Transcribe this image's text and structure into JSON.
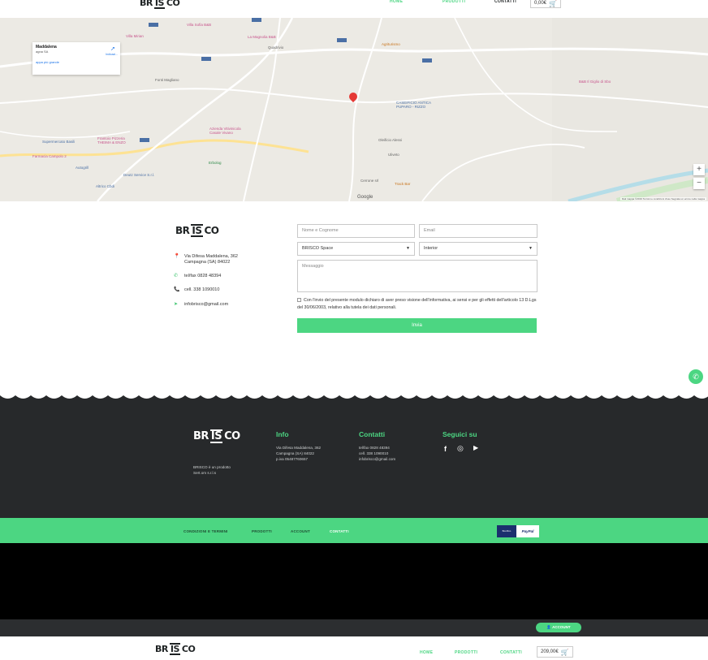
{
  "brand": {
    "left": "BR",
    "mid": "IS",
    "right": "CO"
  },
  "nav": {
    "home": "HOME",
    "products": "PRODOTTI",
    "contacts": "CONTATTI",
    "cart_total": "0,00€"
  },
  "map": {
    "card_title": "Maddalena",
    "card_subtitle": "agna SA",
    "card_link": "appa più grande",
    "directions_label": "Indicazi...",
    "zoom_in": "+",
    "zoom_out": "−",
    "google": "Google",
    "attribution": "Dati mappa ©2019   Termini e condizioni d'uso   Segnala un errore nella mappa",
    "labels": {
      "villa_sofia": "Villa Sofia B&B",
      "la_magnolia": "La Magnolia B&B",
      "quadrivio": "Quadrivio",
      "villa_mirian": "Villa Mirian",
      "agriturismo": "Agriturismo",
      "fonti_magliano": "Fonti Magliano",
      "caseificio": "CASEIFICIO ANTICA\nPUPARO - RIZZO",
      "azienda": "Azienda Vitivinicola\nCasale Vivano",
      "supermercato": "Supermercato Basili",
      "frantoio": "Frantoio Pizzeria\nTHEIMA & ENZO",
      "farmacia": "Farmacia Campolo 2",
      "autogrill": "Autogrill",
      "deutz": "Deutz Service S.r.l.",
      "altrico": "Altrico  Cbdi",
      "erbolog": "Erbolog",
      "oleificio": "Oleificio Alessi",
      "uliveto": "Uliveto",
      "track_bar": "Track Bar",
      "cerrone": "Cerrone srl",
      "bb_right": "B&B Il Giglio di Sbo"
    }
  },
  "contact_info": {
    "address": "Via Difesa Maddalena, 362\nCampagna (SA) 84022",
    "telfax": "tel/fax 0828 48394",
    "cell": "cell. 338 1090010",
    "email": "infobrisco@gmail.com"
  },
  "form": {
    "name_placeholder": "Nome e Cognome",
    "email_placeholder": "Email",
    "space_select": "BRISCO Space",
    "type_select": "Interior",
    "message_placeholder": "Messaggio",
    "consent": "Con l'invio del presente modulo dichiaro di aver preso visione dell'informativa, ai sensi e per gli effetti dell'articolo 13 D.Lgs del 30/06/2003, relativo alla tutela dei dati personali.",
    "submit": "Invia"
  },
  "footer": {
    "tagline": "BRISCO è un prodotto\nSert.om s.r.l.s",
    "info_head": "Info",
    "info_text": "Via Difesa Maddalena, 362\nCampagna (SA) 84022\np.iva 05487760657",
    "contacts_head": "Contatti",
    "contacts_text": "tel/fax 0828 48394\ncell. 338 1090010\ninfobrisco@gmail.com",
    "follow_head": "Seguici su"
  },
  "legal": {
    "terms": "CONDIZIONI E TERMINI",
    "products": "PRODOTTI",
    "account": "ACCOUNT",
    "contacts": "CONTATTI",
    "pay_a": "Bonifico",
    "pay_b": "PayPal"
  },
  "second": {
    "account_btn": "ACCOUNT",
    "cart_total": "209,00€"
  },
  "colors": {
    "accent": "#4cd682",
    "dark": "#27292b"
  }
}
